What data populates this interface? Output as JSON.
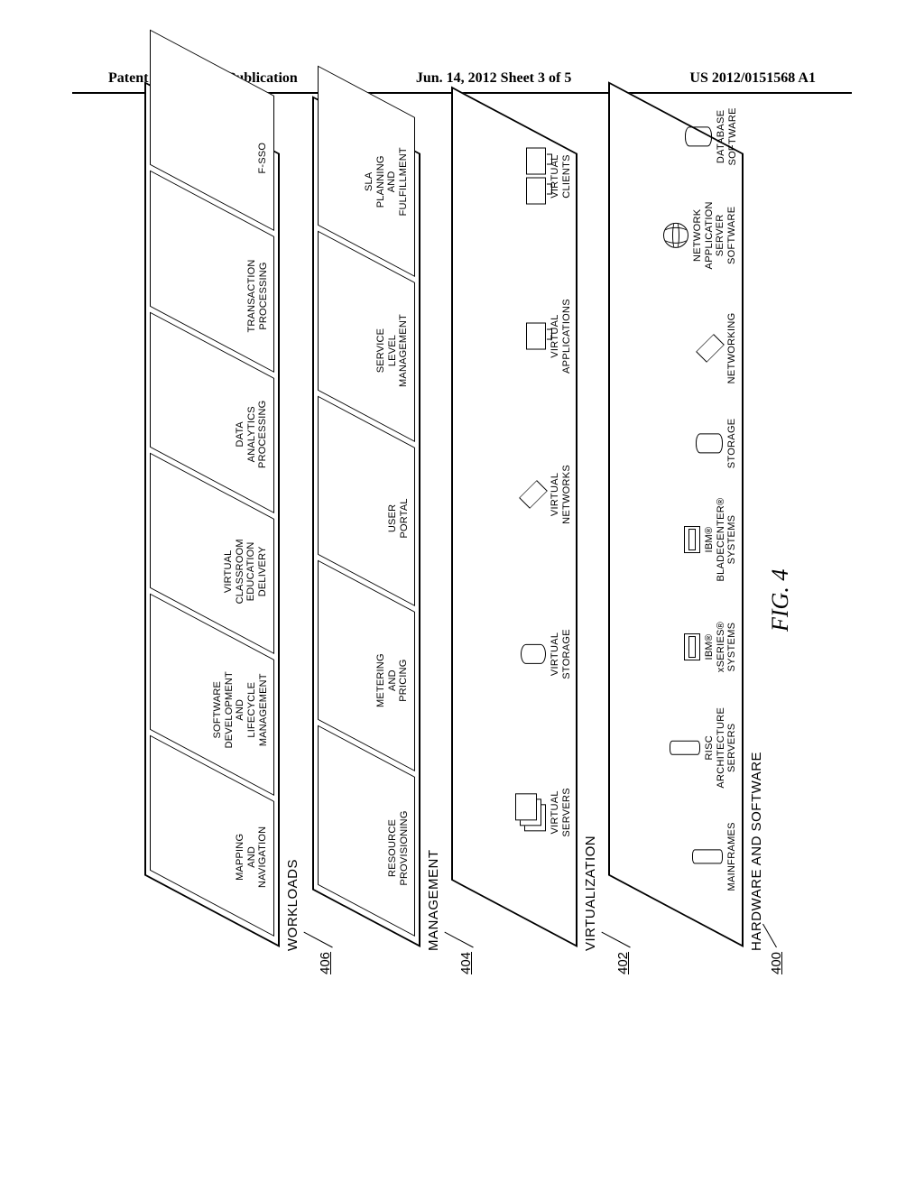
{
  "header": {
    "left": "Patent Application Publication",
    "center": "Jun. 14, 2012  Sheet 3 of 5",
    "right": "US 2012/0151568 A1"
  },
  "figure": {
    "caption": "FIG. 4",
    "layers": [
      {
        "ref": "",
        "label": "WORKLOADS",
        "cells": [
          "MAPPING\nAND\nNAVIGATION",
          "SOFTWARE\nDEVELOPMENT\nAND\nLIFECYCLE\nMANAGEMENT",
          "VIRTUAL\nCLASSROOM\nEDUCATION\nDELIVERY",
          "DATA\nANALYTICS\nPROCESSING",
          "TRANSACTION\nPROCESSING",
          "F-SSO"
        ]
      },
      {
        "ref": "406",
        "label": "MANAGEMENT",
        "cells": [
          "RESOURCE\nPROVISIONING",
          "METERING\nAND\nPRICING",
          "USER\nPORTAL",
          "SERVICE\nLEVEL\nMANAGEMENT",
          "SLA\nPLANNING\nAND\nFULFILLMENT"
        ]
      },
      {
        "ref": "404",
        "label": "VIRTUALIZATION",
        "tiles": [
          {
            "icon": "stack3",
            "cap": "VIRTUAL\nSERVERS"
          },
          {
            "icon": "disk",
            "cap": "VIRTUAL\nSTORAGE"
          },
          {
            "icon": "cube",
            "cap": "VIRTUAL\nNETWORKS"
          },
          {
            "icon": "monitor",
            "cap": "VIRTUAL\nAPPLICATIONS"
          },
          {
            "icon": "monitor2",
            "cap": "VIRTUAL\nCLIENTS"
          }
        ]
      },
      {
        "ref": "402",
        "label": "HARDWARE AND SOFTWARE",
        "tiles": [
          {
            "icon": "tower",
            "cap": "MAINFRAMES"
          },
          {
            "icon": "tower",
            "cap": "RISC\nARCHITECTURE\nSERVERS"
          },
          {
            "icon": "slab",
            "cap": "IBM®\nxSERIES®\nSYSTEMS"
          },
          {
            "icon": "slab",
            "cap": "IBM®\nBLADECENTER®\nSYSTEMS"
          },
          {
            "icon": "cyl",
            "cap": "STORAGE"
          },
          {
            "icon": "cube",
            "cap": "NETWORKING"
          },
          {
            "icon": "globe",
            "cap": "NETWORK\nAPPLICATION\nSERVER\nSOFTWARE"
          },
          {
            "icon": "cyl",
            "cap": "DATABASE\nSOFTWARE"
          }
        ],
        "bottom_ref": "400"
      }
    ]
  }
}
